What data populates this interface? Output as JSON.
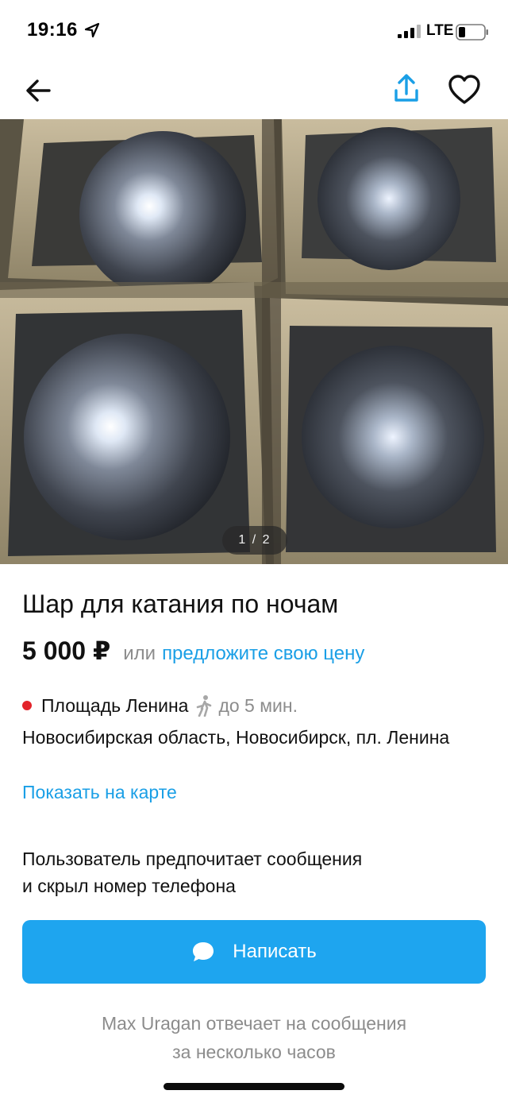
{
  "status_bar": {
    "time": "19:16",
    "network": "LTE",
    "icons": [
      "location-arrow-icon",
      "signal-icon",
      "battery-icon"
    ]
  },
  "nav": {
    "back_icon": "arrow-left-icon",
    "share_icon": "share-icon",
    "favorite_icon": "heart-icon"
  },
  "gallery": {
    "counter": "1 / 2"
  },
  "listing": {
    "title": "Шар для катания по ночам",
    "price": "5 000 ₽",
    "price_or": "или",
    "price_offer_link": "предложите свою цену",
    "metro_station": "Площадь Ленина",
    "walk_time": "до 5 мин.",
    "address": "Новосибирская область, Новосибирск, пл. Ленина",
    "map_link": "Показать на карте",
    "contact_preference_line1": "Пользователь предпочитает сообщения",
    "contact_preference_line2": "и скрыл номер телефона",
    "write_button": "Написать",
    "reply_note_line1": "Max Uragan отвечает на сообщения",
    "reply_note_line2": "за несколько часов"
  },
  "colors": {
    "accent": "#1ea5ef",
    "link": "#1a9fe6",
    "metro": "#e3242b",
    "muted": "#8c8c8c"
  }
}
